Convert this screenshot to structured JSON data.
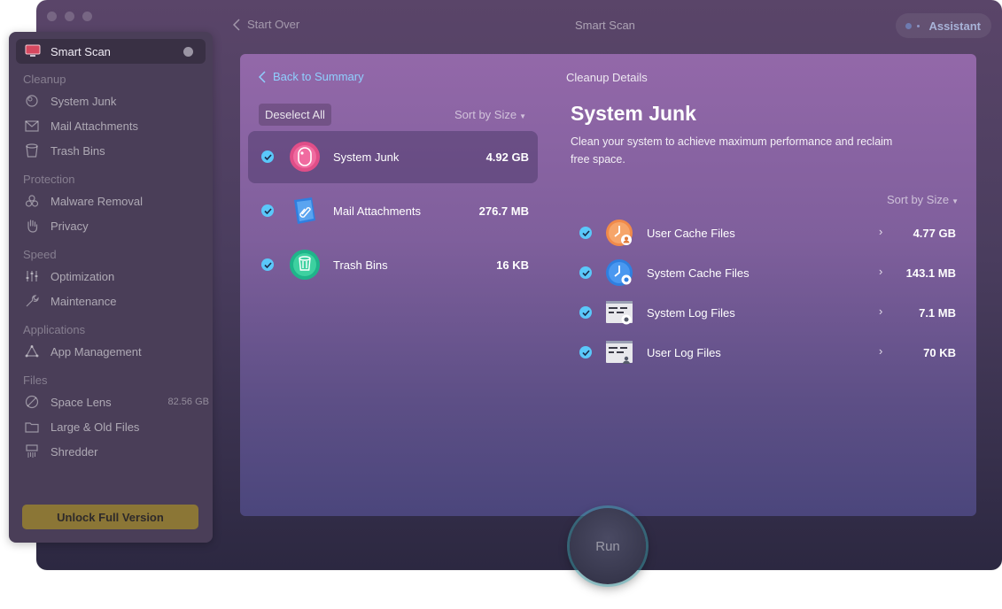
{
  "window": {
    "back_label": "Start Over",
    "title": "Smart Scan",
    "assistant_label": "Assistant"
  },
  "sidebar": {
    "active": {
      "label": "Smart Scan",
      "icon": "monitor-icon"
    },
    "sections": [
      {
        "title": "Cleanup",
        "items": [
          {
            "label": "System Junk",
            "icon": "junk-icon"
          },
          {
            "label": "Mail Attachments",
            "icon": "mail-icon"
          },
          {
            "label": "Trash Bins",
            "icon": "trash-icon"
          }
        ]
      },
      {
        "title": "Protection",
        "items": [
          {
            "label": "Malware Removal",
            "icon": "biohazard-icon"
          },
          {
            "label": "Privacy",
            "icon": "hand-icon"
          }
        ]
      },
      {
        "title": "Speed",
        "items": [
          {
            "label": "Optimization",
            "icon": "sliders-icon"
          },
          {
            "label": "Maintenance",
            "icon": "wrench-icon"
          }
        ]
      },
      {
        "title": "Applications",
        "items": [
          {
            "label": "App Management",
            "icon": "apps-icon"
          }
        ]
      },
      {
        "title": "Files",
        "items": [
          {
            "label": "Space Lens",
            "icon": "lens-icon",
            "size": "82.56 GB"
          },
          {
            "label": "Large & Old Files",
            "icon": "folder-icon"
          },
          {
            "label": "Shredder",
            "icon": "shredder-icon"
          }
        ]
      }
    ],
    "unlock_label": "Unlock Full Version"
  },
  "left_pane": {
    "back_label": "Back to Summary",
    "deselect_label": "Deselect All",
    "sort_label": "Sort by Size",
    "categories": [
      {
        "name": "System Junk",
        "value": "4.92 GB",
        "selected": true,
        "icon": "system-junk-icon"
      },
      {
        "name": "Mail Attachments",
        "value": "276.7 MB",
        "selected": false,
        "icon": "mail-attachments-icon"
      },
      {
        "name": "Trash Bins",
        "value": "16 KB",
        "selected": false,
        "icon": "trash-bins-icon"
      }
    ]
  },
  "details": {
    "header": "Cleanup Details",
    "title": "System Junk",
    "description": "Clean your system to achieve maximum performance and reclaim free space.",
    "sort_label": "Sort by Size",
    "items": [
      {
        "name": "User Cache Files",
        "value": "4.77 GB",
        "icon": "user-cache-icon"
      },
      {
        "name": "System Cache Files",
        "value": "143.1 MB",
        "icon": "system-cache-icon"
      },
      {
        "name": "System Log Files",
        "value": "7.1 MB",
        "icon": "system-log-icon"
      },
      {
        "name": "User Log Files",
        "value": "70 KB",
        "icon": "user-log-icon"
      }
    ]
  },
  "run_label": "Run",
  "colors": {
    "accent": "#5ac8fa",
    "link": "#8fd0ff",
    "unlock": "#8b7636"
  }
}
